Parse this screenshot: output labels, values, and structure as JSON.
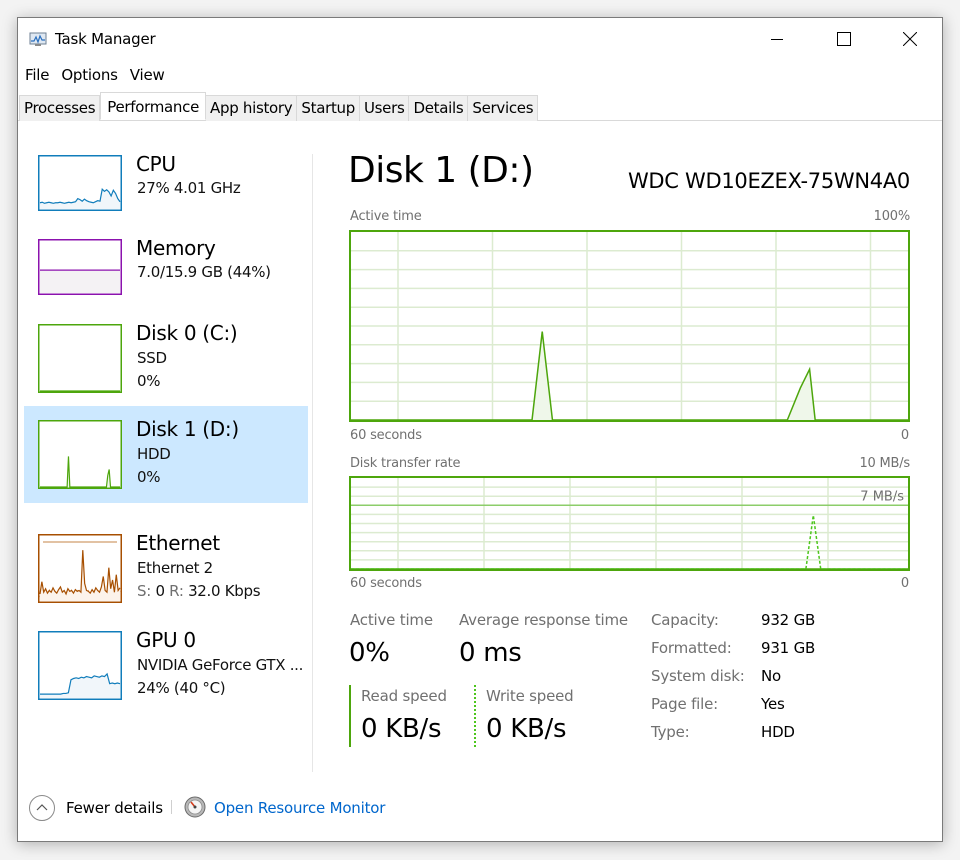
{
  "window": {
    "title": "Task Manager",
    "controls": {
      "minimize": "minimize",
      "maximize": "maximize",
      "close": "close"
    }
  },
  "menu": [
    "File",
    "Options",
    "View"
  ],
  "tabs": [
    {
      "label": "Processes",
      "active": false
    },
    {
      "label": "Performance",
      "active": true
    },
    {
      "label": "App history",
      "active": false
    },
    {
      "label": "Startup",
      "active": false
    },
    {
      "label": "Users",
      "active": false
    },
    {
      "label": "Details",
      "active": false
    },
    {
      "label": "Services",
      "active": false
    }
  ],
  "sidebar": {
    "items": [
      {
        "name": "CPU",
        "line1": "27%  4.01 GHz",
        "line2": "",
        "color": "#117dbb",
        "fill": "#f1f6fa",
        "selected": false,
        "series": [
          12,
          13,
          11,
          12,
          13,
          12,
          11,
          12,
          12,
          13,
          12,
          11,
          12,
          13,
          12,
          13,
          14,
          20,
          18,
          15,
          19,
          16,
          14,
          13,
          12,
          14,
          16,
          15,
          38,
          34,
          37,
          33,
          25,
          36,
          30,
          20,
          14
        ]
      },
      {
        "name": "Memory",
        "line1": "7.0/15.9 GB (44%)",
        "line2": "",
        "color": "#8b12ae",
        "fill": "#f4f2f4",
        "selected": false,
        "series": [
          44,
          44,
          44,
          44,
          44,
          44,
          44,
          44,
          44,
          44,
          44,
          44,
          44,
          44,
          44,
          44,
          44,
          44,
          44,
          44
        ]
      },
      {
        "name": "Disk 0 (C:)",
        "line1": "SSD",
        "line2": "0%",
        "color": "#4da60c",
        "fill": "#eff7ea",
        "selected": false,
        "series": [
          0,
          0,
          0,
          0,
          0,
          0,
          0,
          0,
          0,
          0,
          0,
          0,
          0,
          0,
          0,
          0,
          0,
          0,
          0,
          0
        ]
      },
      {
        "name": "Disk 1 (D:)",
        "line1": "HDD",
        "line2": "0%",
        "color": "#4da60c",
        "fill": "#eff7ea",
        "selected": true,
        "series": [
          0,
          0,
          0,
          0,
          0,
          0,
          0,
          0,
          0,
          0,
          0,
          0,
          0,
          0,
          0,
          0,
          0,
          0,
          0,
          0,
          0,
          47,
          0,
          0,
          0,
          0,
          0,
          0,
          0,
          0,
          0,
          0,
          0,
          0,
          0,
          0,
          0,
          0,
          0,
          0,
          0,
          0,
          0,
          0,
          0,
          0,
          0,
          0,
          0,
          0,
          18,
          27,
          0,
          0,
          0,
          0,
          0,
          0,
          0,
          0
        ]
      },
      {
        "name": "Ethernet",
        "line1": "Ethernet 2",
        "sent_label": "S:",
        "sent": "0",
        "recv_label": "R:",
        "recv": "32.0 Kbps",
        "color": "#a74f01",
        "fill": "#fcf3eb",
        "selected": false,
        "series": [
          8,
          22,
          10,
          14,
          9,
          12,
          10,
          15,
          11,
          9,
          13,
          16,
          10,
          12,
          8,
          14,
          11,
          12,
          9,
          13,
          11,
          12,
          10,
          58,
          20,
          12,
          11,
          9,
          13,
          10,
          15,
          12,
          10,
          16,
          28,
          12,
          10,
          38,
          14,
          24,
          10,
          30,
          12,
          15
        ]
      },
      {
        "name": "GPU 0",
        "line1": "NVIDIA GeForce GTX ...",
        "line2": "24%  (40 °C)",
        "color": "#117dbb",
        "fill": "#f1f6fa",
        "selected": false,
        "series": [
          6,
          6,
          6,
          6,
          6,
          6,
          6,
          6,
          6,
          7,
          7,
          8,
          28,
          30,
          31,
          30,
          32,
          31,
          33,
          32,
          31,
          34,
          33,
          32,
          34,
          33,
          37,
          22,
          23,
          22,
          23,
          22
        ]
      }
    ]
  },
  "main": {
    "title": "Disk 1 (D:)",
    "model": "WDC WD10EZEX-75WN4A0",
    "active_chart": {
      "label": "Active time",
      "max_label": "100%",
      "time_label": "60 seconds",
      "min_label": "0"
    },
    "transfer_chart": {
      "label": "Disk transfer rate",
      "max_label": "10 MB/s",
      "marker_label": "7 MB/s",
      "time_label": "60 seconds",
      "min_label": "0"
    },
    "stats": {
      "active_time_label": "Active time",
      "active_time_value": "0%",
      "avg_response_label": "Average response time",
      "avg_response_value": "0 ms",
      "read_label": "Read speed",
      "read_value": "0 KB/s",
      "write_label": "Write speed",
      "write_value": "0 KB/s"
    },
    "properties": [
      {
        "label": "Capacity:",
        "value": "932 GB"
      },
      {
        "label": "Formatted:",
        "value": "931 GB"
      },
      {
        "label": "System disk:",
        "value": "No"
      },
      {
        "label": "Page file:",
        "value": "Yes"
      },
      {
        "label": "Type:",
        "value": "HDD"
      }
    ]
  },
  "chart_data": [
    {
      "type": "area",
      "title": "Active time",
      "xlabel": "60 seconds",
      "ylabel": "",
      "x_range_seconds": [
        60,
        0
      ],
      "ylim": [
        0,
        100
      ],
      "y_unit": "%",
      "grid": true,
      "color": "#4da60c",
      "points": [
        {
          "seconds_ago": 60,
          "value": 0
        },
        {
          "seconds_ago": 40.5,
          "value": 0
        },
        {
          "seconds_ago": 39.4,
          "value": 47
        },
        {
          "seconds_ago": 38.3,
          "value": 0
        },
        {
          "seconds_ago": 13.0,
          "value": 0
        },
        {
          "seconds_ago": 11.6,
          "value": 17
        },
        {
          "seconds_ago": 10.6,
          "value": 27
        },
        {
          "seconds_ago": 10.0,
          "value": 0
        },
        {
          "seconds_ago": 0,
          "value": 0
        }
      ]
    },
    {
      "type": "line",
      "title": "Disk transfer rate",
      "xlabel": "60 seconds",
      "ylabel": "",
      "x_range_seconds": [
        60,
        0
      ],
      "ylim": [
        0,
        10
      ],
      "y_unit": "MB/s",
      "grid": true,
      "annotations": [
        {
          "y": 7,
          "label": "7 MB/s"
        }
      ],
      "series": [
        {
          "name": "Read speed",
          "style": "solid",
          "color": "#4da60c",
          "points": [
            {
              "seconds_ago": 60,
              "value": 0
            },
            {
              "seconds_ago": 0,
              "value": 0
            }
          ]
        },
        {
          "name": "Write speed",
          "style": "dashed",
          "color": "#4dc61c",
          "points": [
            {
              "seconds_ago": 60,
              "value": 0
            },
            {
              "seconds_ago": 11.0,
              "value": 0
            },
            {
              "seconds_ago": 10.2,
              "value": 5.9
            },
            {
              "seconds_ago": 9.4,
              "value": 0
            },
            {
              "seconds_ago": 0,
              "value": 0
            }
          ]
        }
      ]
    }
  ],
  "footer": {
    "fewer_details": "Fewer details",
    "open_resource_monitor": "Open Resource Monitor"
  }
}
